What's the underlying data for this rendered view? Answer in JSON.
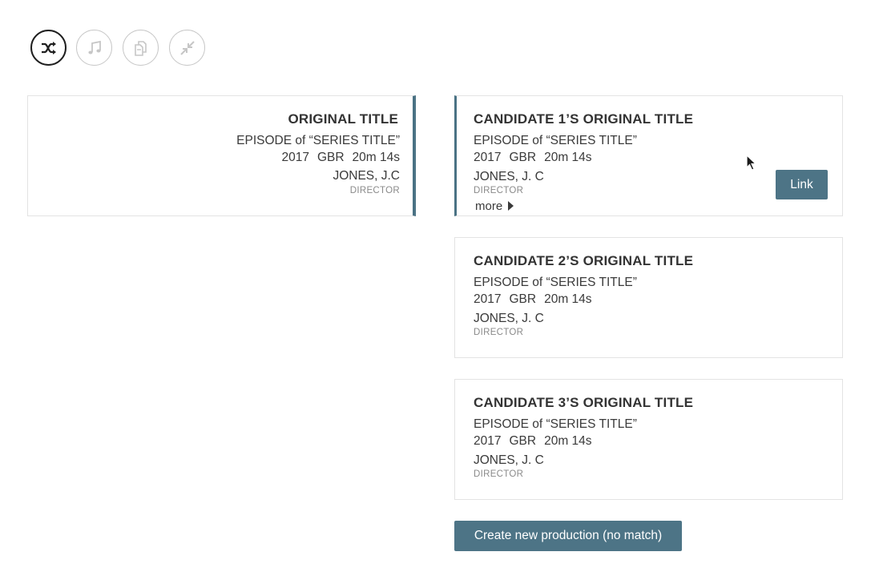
{
  "toolbar": {
    "buttons": [
      {
        "icon": "shuffle-icon",
        "active": true
      },
      {
        "icon": "music-note-icon",
        "active": false
      },
      {
        "icon": "copy-pages-icon",
        "active": false
      },
      {
        "icon": "compress-icon",
        "active": false
      }
    ]
  },
  "original": {
    "title": "ORIGINAL TITLE",
    "episode": "EPISODE of “SERIES TITLE”",
    "year": "2017",
    "country": "GBR",
    "duration": "20m 14s",
    "person": "JONES, J.C",
    "role": "DIRECTOR"
  },
  "candidates": [
    {
      "title": "CANDIDATE 1’S ORIGINAL TITLE",
      "episode": "EPISODE of “SERIES TITLE”",
      "year": "2017",
      "country": "GBR",
      "duration": "20m 14s",
      "person": "JONES, J. C",
      "role": "DIRECTOR",
      "more_label": "more",
      "link_label": "Link"
    },
    {
      "title": "CANDIDATE 2’S ORIGINAL TITLE",
      "episode": "EPISODE of “SERIES TITLE”",
      "year": "2017",
      "country": "GBR",
      "duration": "20m 14s",
      "person": "JONES, J. C",
      "role": "DIRECTOR"
    },
    {
      "title": "CANDIDATE 3’S ORIGINAL TITLE",
      "episode": "EPISODE of “SERIES TITLE”",
      "year": "2017",
      "country": "GBR",
      "duration": "20m 14s",
      "person": "JONES, J. C",
      "role": "DIRECTOR"
    }
  ],
  "actions": {
    "create_label": "Create new production (no match)"
  },
  "colors": {
    "accent": "#4d7486",
    "accent_border": "#4a7284"
  }
}
